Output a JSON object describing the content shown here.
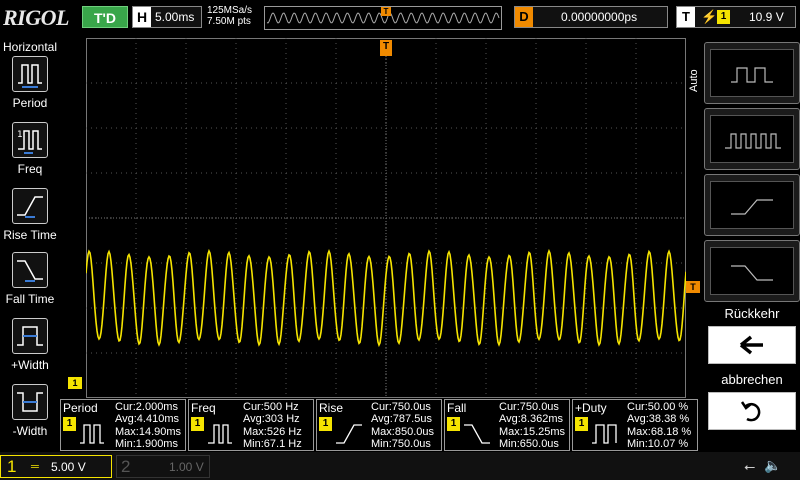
{
  "header": {
    "logo": "RIGOL",
    "run_status": "T'D",
    "horizontal": {
      "label": "H",
      "timebase": "5.00ms"
    },
    "sample": {
      "rate": "125MSa/s",
      "points": "7.50M pts"
    },
    "delay": {
      "label": "D",
      "value": "0.00000000ps"
    },
    "trigger": {
      "label": "T",
      "edge_icon": "rising-edge-icon",
      "channel": "1",
      "level": "10.9 V"
    }
  },
  "left_menu": {
    "title": "Horizontal",
    "items": [
      {
        "label": "Period",
        "icon": "period-icon"
      },
      {
        "label": "Freq",
        "icon": "frequency-icon"
      },
      {
        "label": "Rise Time",
        "icon": "rise-time-icon"
      },
      {
        "label": "Fall Time",
        "icon": "fall-time-icon"
      },
      {
        "label": "+Width",
        "icon": "positive-width-icon"
      },
      {
        "label": "-Width",
        "icon": "negative-width-icon"
      }
    ]
  },
  "right_menu": {
    "auto_label": "Auto",
    "back_label": "Rückkehr",
    "cancel_label": "abbrechen"
  },
  "markers": {
    "trigger_pos": "T",
    "trigger_level": "T",
    "channel_ground": "1"
  },
  "colors": {
    "channel1": "#f5e400",
    "trigger": "#f08a00",
    "run_status": "#39a64a",
    "grid": "#5a5a5a"
  },
  "waveform": {
    "cycles": 30,
    "shape": "sine"
  },
  "measurements": [
    {
      "name": "Period",
      "channel": "1",
      "icon": "period-icon",
      "cur": "Cur:2.000ms",
      "avg": "Avg:4.410ms",
      "max": "Max:14.90ms",
      "min": "Min:1.900ms"
    },
    {
      "name": "Freq",
      "channel": "1",
      "icon": "frequency-icon",
      "cur": "Cur:500 Hz",
      "avg": "Avg:303 Hz",
      "max": "Max:526 Hz",
      "min": "Min:67.1 Hz"
    },
    {
      "name": "Rise",
      "channel": "1",
      "icon": "rise-time-icon",
      "cur": "Cur:750.0us",
      "avg": "Avg:787.5us",
      "max": "Max:850.0us",
      "min": "Min:750.0us"
    },
    {
      "name": "Fall",
      "channel": "1",
      "icon": "fall-time-icon",
      "cur": "Cur:750.0us",
      "avg": "Avg:8.362ms",
      "max": "Max:15.25ms",
      "min": "Min:650.0us"
    },
    {
      "name": "+Duty",
      "channel": "1",
      "icon": "positive-duty-icon",
      "cur": "Cur:50.00 %",
      "avg": "Avg:38.38 %",
      "max": "Max:68.18 %",
      "min": "Min:10.07 %"
    }
  ],
  "bottom": {
    "ch1": {
      "number": "1",
      "coupling": "═",
      "scale": "5.00 V"
    },
    "ch2": {
      "number": "2",
      "scale": "1.00 V"
    },
    "usb_icon": "usb-icon",
    "speaker_icon": "speaker-muted-icon"
  }
}
